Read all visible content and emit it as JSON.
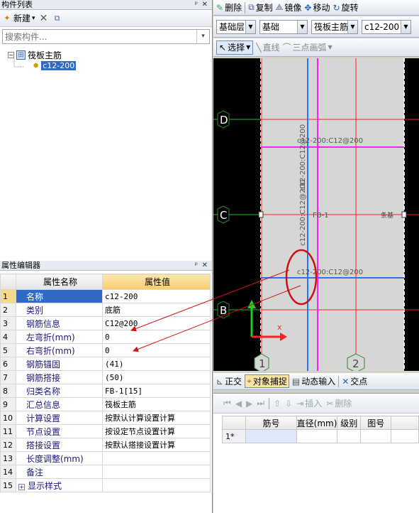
{
  "component_list": {
    "title": "构件列表",
    "toolbar": {
      "new_label": "新建",
      "new_arrow": "▾"
    },
    "search_placeholder": "搜索构件...",
    "tree": {
      "root": "筏板主筋",
      "child": "c12-200"
    }
  },
  "property_editor": {
    "title": "属性编辑器",
    "headers": {
      "name": "属性名称",
      "value": "属性值"
    },
    "rows": [
      {
        "num": "1",
        "name": "名称",
        "value": "c12-200"
      },
      {
        "num": "2",
        "name": "类别",
        "value": "底筋"
      },
      {
        "num": "3",
        "name": "钢筋信息",
        "value": "C12@200"
      },
      {
        "num": "4",
        "name": "左弯折(mm)",
        "value": "0"
      },
      {
        "num": "5",
        "name": "右弯折(mm)",
        "value": "0"
      },
      {
        "num": "6",
        "name": "钢筋锚固",
        "value": "(41)"
      },
      {
        "num": "7",
        "name": "钢筋搭接",
        "value": "(50)"
      },
      {
        "num": "8",
        "name": "归类名称",
        "value": "FB-1[15]"
      },
      {
        "num": "9",
        "name": "汇总信息",
        "value": "筏板主筋"
      },
      {
        "num": "10",
        "name": "计算设置",
        "value": "按默认计算设置计算"
      },
      {
        "num": "11",
        "name": "节点设置",
        "value": "按设定节点设置计算"
      },
      {
        "num": "12",
        "name": "搭接设置",
        "value": "按默认搭接设置计算"
      },
      {
        "num": "13",
        "name": "长度调整(mm)",
        "value": ""
      },
      {
        "num": "14",
        "name": "备注",
        "value": ""
      },
      {
        "num": "15",
        "name": "显示样式",
        "value": ""
      }
    ]
  },
  "edit_toolbar": {
    "delete": "删除",
    "copy": "复制",
    "mirror": "镜像",
    "move": "移动",
    "rotate": "旋转"
  },
  "layer_toolbar": {
    "floor": "基础层",
    "category": "基础",
    "type": "筏板主筋",
    "item": "c12-200"
  },
  "draw_toolbar": {
    "select": "选择",
    "line": "直线",
    "arc": "三点画弧"
  },
  "canvas": {
    "axis_labels": [
      "D",
      "C",
      "B",
      "1",
      "2"
    ],
    "rebar_labels": [
      "c12-200:C12@200",
      "c12-200:C12@200",
      "c12-200:C12@200",
      "c12-200:C12@200"
    ],
    "fb_label": "FB-1",
    "edge_label": "条基",
    "colors": {
      "background": "#000000",
      "slab": "#d6d6d6",
      "axis": "#ff2020",
      "rebar_blue": "#1e78ff",
      "rebar_magenta": "#ff20ff",
      "annot": "#d01010"
    }
  },
  "status_toolbar": {
    "ortho": "正交",
    "snap": "对象捕捉",
    "dynamic": "动态输入",
    "intersect": "交点"
  },
  "rebar_grid": {
    "toolbar": {
      "insert": "插入",
      "delete": "删除"
    },
    "headers": [
      "筋号",
      "直径(mm)",
      "级别",
      "图号"
    ],
    "row_label": "1*"
  }
}
